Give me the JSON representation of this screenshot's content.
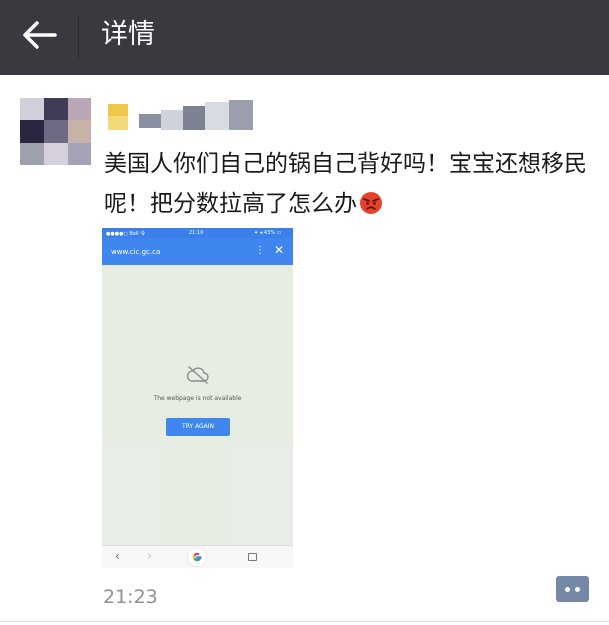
{
  "header": {
    "title": "详情",
    "back_icon": "arrow-left-icon"
  },
  "post": {
    "text": "美国人你们自己的锅自己背好吗！宝宝还想移民呢！把分数拉高了怎么办",
    "emoji_icon": "angry-face-icon",
    "time": "21:23",
    "comment_icon": "comment-dots-icon"
  },
  "attachment": {
    "status_carrier": "●●●●○ Bell 令",
    "status_time": "21:10",
    "status_battery": "✦ ◂ 43% ▭",
    "url": "www.cic.gc.ca",
    "error_text": "The webpage is not available",
    "button_label": "TRY AGAIN"
  },
  "colors": {
    "topbar": "#393a3f",
    "browser_blue": "#3f87ee",
    "comment_button": "#7688a8"
  }
}
